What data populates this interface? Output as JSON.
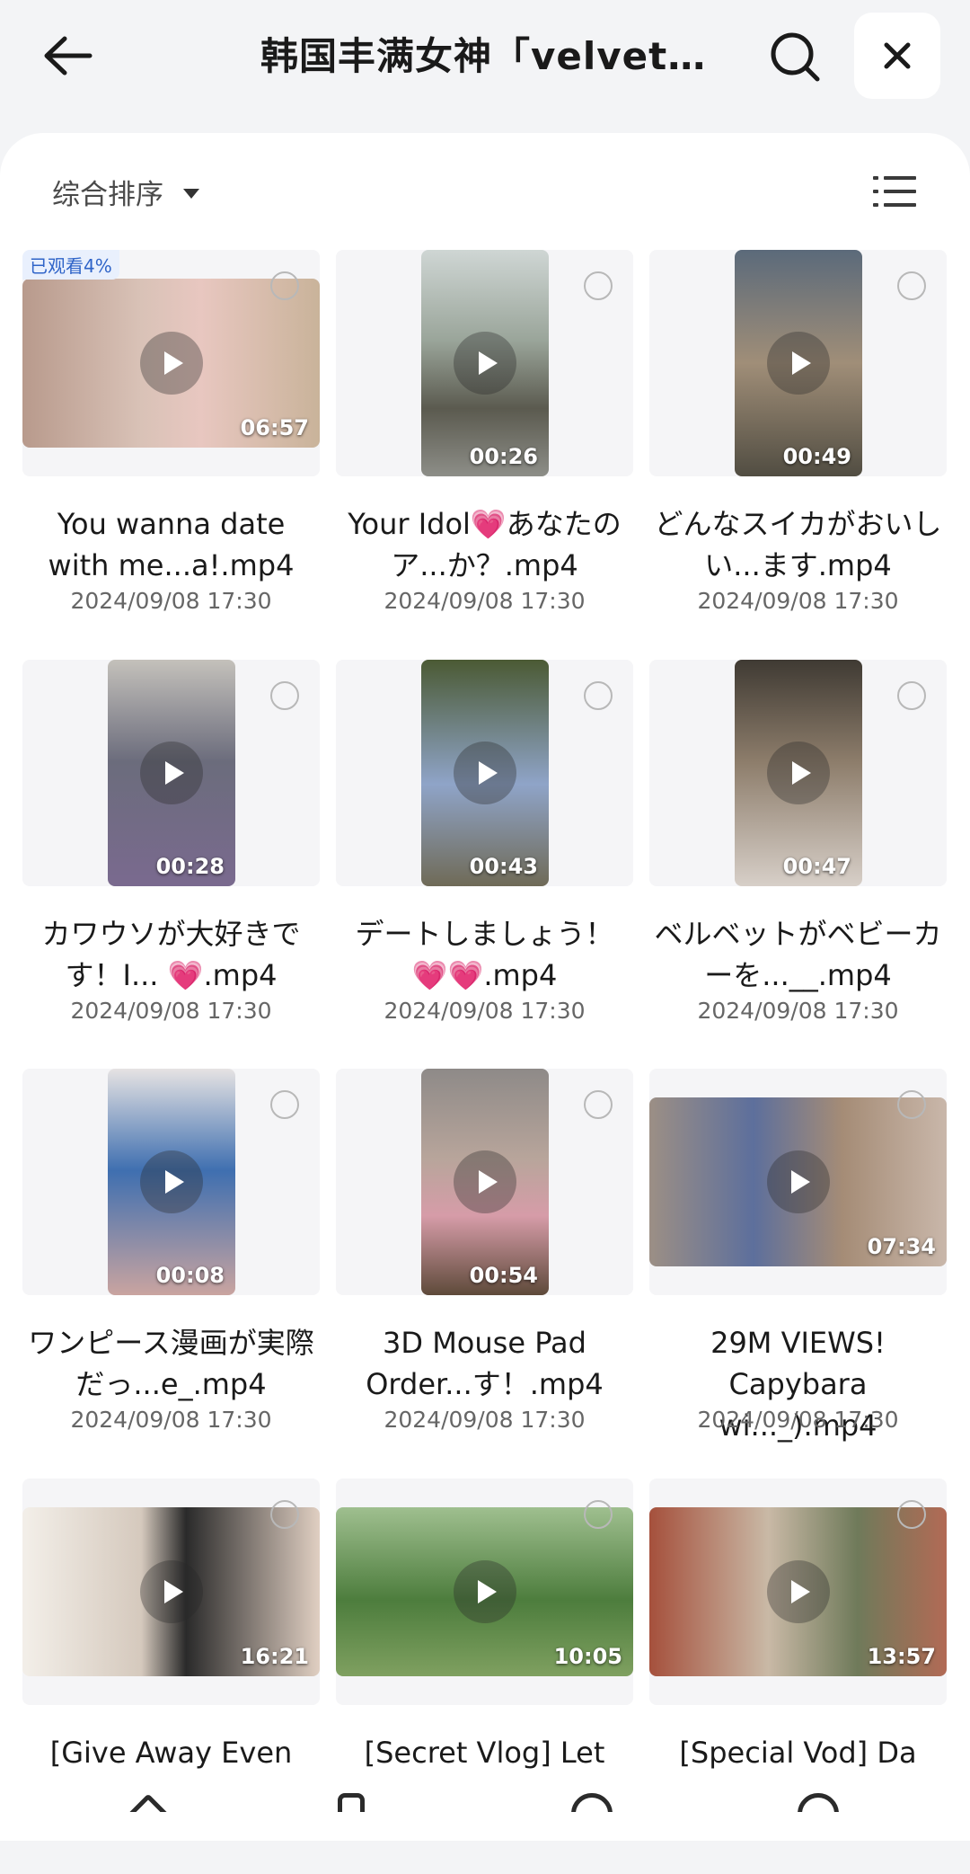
{
  "header": {
    "title": "韩国丰满女神「velvet…",
    "back_icon": "arrow-left-icon",
    "search_icon": "search-icon",
    "close_icon": "close-icon"
  },
  "toolbar": {
    "sort_label": "综合排序",
    "list_view_icon": "list-view-icon"
  },
  "videos": [
    {
      "name": "You wanna date with me...a!.mp4",
      "date": "2024/09/08 17:30",
      "duration": "06:57",
      "badge": "已观看4%",
      "orientation": "landscape"
    },
    {
      "name": "Your Idol💗あなたのア...か？.mp4",
      "date": "2024/09/08 17:30",
      "duration": "00:26",
      "orientation": "portrait"
    },
    {
      "name": "どんなスイカがおいしい...ます.mp4",
      "date": "2024/09/08 17:30",
      "duration": "00:49",
      "orientation": "portrait"
    },
    {
      "name": "カワウソが大好きです！I... 💗.mp4",
      "date": "2024/09/08 17:30",
      "duration": "00:28",
      "orientation": "portrait"
    },
    {
      "name": "デートしましょう！ 💗💗.mp4",
      "date": "2024/09/08 17:30",
      "duration": "00:43",
      "orientation": "portrait"
    },
    {
      "name": "ベルベットがベビーカーを...__.mp4",
      "date": "2024/09/08 17:30",
      "duration": "00:47",
      "orientation": "portrait"
    },
    {
      "name": "ワンピース漫画が実際だっ...e_.mp4",
      "date": "2024/09/08 17:30",
      "duration": "00:08",
      "orientation": "portrait"
    },
    {
      "name": "3D Mouse Pad Order...す！.mp4",
      "date": "2024/09/08 17:30",
      "duration": "00:54",
      "orientation": "portrait"
    },
    {
      "name": "29M VIEWS! Capybara wi..._).mp4",
      "date": "2024/09/08 17:30",
      "duration": "07:34",
      "orientation": "landscape"
    },
    {
      "name": "[Give Away Even",
      "date": "",
      "duration": "16:21",
      "orientation": "landscape"
    },
    {
      "name": "[Secret Vlog] Let",
      "date": "",
      "duration": "10:05",
      "orientation": "landscape"
    },
    {
      "name": "[Special Vod] Da",
      "date": "",
      "duration": "13:57",
      "orientation": "landscape"
    }
  ],
  "colors": {
    "background": "#f3f4f6",
    "panel": "#ffffff",
    "badge_text": "#2f64c8",
    "badge_bg": "#e9f0fd"
  }
}
